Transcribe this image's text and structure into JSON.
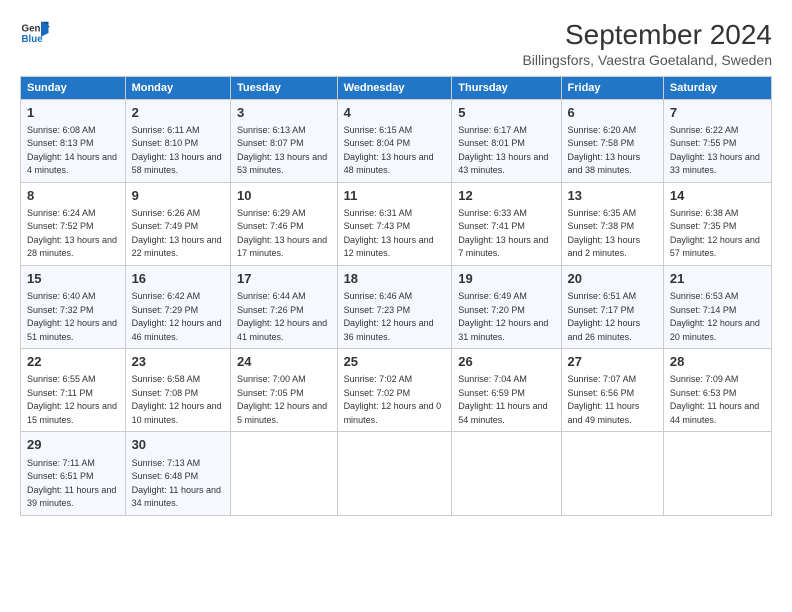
{
  "logo": {
    "line1": "General",
    "line2": "Blue"
  },
  "title": "September 2024",
  "subtitle": "Billingsfors, Vaestra Goetaland, Sweden",
  "days_of_week": [
    "Sunday",
    "Monday",
    "Tuesday",
    "Wednesday",
    "Thursday",
    "Friday",
    "Saturday"
  ],
  "weeks": [
    [
      {
        "num": "1",
        "sunrise": "6:08 AM",
        "sunset": "8:13 PM",
        "daylight": "14 hours and 4 minutes."
      },
      {
        "num": "2",
        "sunrise": "6:11 AM",
        "sunset": "8:10 PM",
        "daylight": "13 hours and 58 minutes."
      },
      {
        "num": "3",
        "sunrise": "6:13 AM",
        "sunset": "8:07 PM",
        "daylight": "13 hours and 53 minutes."
      },
      {
        "num": "4",
        "sunrise": "6:15 AM",
        "sunset": "8:04 PM",
        "daylight": "13 hours and 48 minutes."
      },
      {
        "num": "5",
        "sunrise": "6:17 AM",
        "sunset": "8:01 PM",
        "daylight": "13 hours and 43 minutes."
      },
      {
        "num": "6",
        "sunrise": "6:20 AM",
        "sunset": "7:58 PM",
        "daylight": "13 hours and 38 minutes."
      },
      {
        "num": "7",
        "sunrise": "6:22 AM",
        "sunset": "7:55 PM",
        "daylight": "13 hours and 33 minutes."
      }
    ],
    [
      {
        "num": "8",
        "sunrise": "6:24 AM",
        "sunset": "7:52 PM",
        "daylight": "13 hours and 28 minutes."
      },
      {
        "num": "9",
        "sunrise": "6:26 AM",
        "sunset": "7:49 PM",
        "daylight": "13 hours and 22 minutes."
      },
      {
        "num": "10",
        "sunrise": "6:29 AM",
        "sunset": "7:46 PM",
        "daylight": "13 hours and 17 minutes."
      },
      {
        "num": "11",
        "sunrise": "6:31 AM",
        "sunset": "7:43 PM",
        "daylight": "13 hours and 12 minutes."
      },
      {
        "num": "12",
        "sunrise": "6:33 AM",
        "sunset": "7:41 PM",
        "daylight": "13 hours and 7 minutes."
      },
      {
        "num": "13",
        "sunrise": "6:35 AM",
        "sunset": "7:38 PM",
        "daylight": "13 hours and 2 minutes."
      },
      {
        "num": "14",
        "sunrise": "6:38 AM",
        "sunset": "7:35 PM",
        "daylight": "12 hours and 57 minutes."
      }
    ],
    [
      {
        "num": "15",
        "sunrise": "6:40 AM",
        "sunset": "7:32 PM",
        "daylight": "12 hours and 51 minutes."
      },
      {
        "num": "16",
        "sunrise": "6:42 AM",
        "sunset": "7:29 PM",
        "daylight": "12 hours and 46 minutes."
      },
      {
        "num": "17",
        "sunrise": "6:44 AM",
        "sunset": "7:26 PM",
        "daylight": "12 hours and 41 minutes."
      },
      {
        "num": "18",
        "sunrise": "6:46 AM",
        "sunset": "7:23 PM",
        "daylight": "12 hours and 36 minutes."
      },
      {
        "num": "19",
        "sunrise": "6:49 AM",
        "sunset": "7:20 PM",
        "daylight": "12 hours and 31 minutes."
      },
      {
        "num": "20",
        "sunrise": "6:51 AM",
        "sunset": "7:17 PM",
        "daylight": "12 hours and 26 minutes."
      },
      {
        "num": "21",
        "sunrise": "6:53 AM",
        "sunset": "7:14 PM",
        "daylight": "12 hours and 20 minutes."
      }
    ],
    [
      {
        "num": "22",
        "sunrise": "6:55 AM",
        "sunset": "7:11 PM",
        "daylight": "12 hours and 15 minutes."
      },
      {
        "num": "23",
        "sunrise": "6:58 AM",
        "sunset": "7:08 PM",
        "daylight": "12 hours and 10 minutes."
      },
      {
        "num": "24",
        "sunrise": "7:00 AM",
        "sunset": "7:05 PM",
        "daylight": "12 hours and 5 minutes."
      },
      {
        "num": "25",
        "sunrise": "7:02 AM",
        "sunset": "7:02 PM",
        "daylight": "12 hours and 0 minutes."
      },
      {
        "num": "26",
        "sunrise": "7:04 AM",
        "sunset": "6:59 PM",
        "daylight": "11 hours and 54 minutes."
      },
      {
        "num": "27",
        "sunrise": "7:07 AM",
        "sunset": "6:56 PM",
        "daylight": "11 hours and 49 minutes."
      },
      {
        "num": "28",
        "sunrise": "7:09 AM",
        "sunset": "6:53 PM",
        "daylight": "11 hours and 44 minutes."
      }
    ],
    [
      {
        "num": "29",
        "sunrise": "7:11 AM",
        "sunset": "6:51 PM",
        "daylight": "11 hours and 39 minutes."
      },
      {
        "num": "30",
        "sunrise": "7:13 AM",
        "sunset": "6:48 PM",
        "daylight": "11 hours and 34 minutes."
      },
      null,
      null,
      null,
      null,
      null
    ]
  ]
}
